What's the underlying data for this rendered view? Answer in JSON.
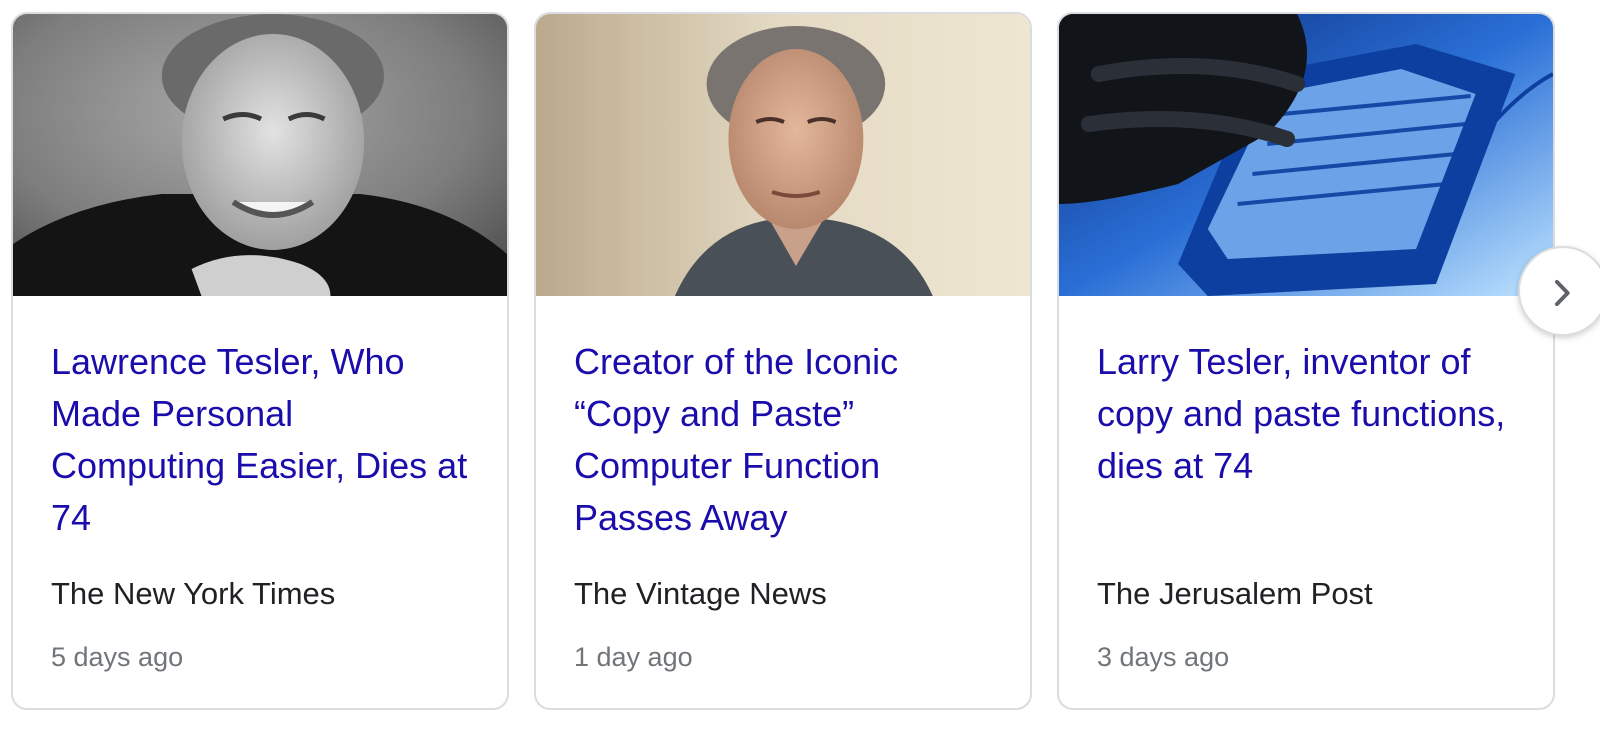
{
  "cards": [
    {
      "headline": "Lawrence Tesler, Who Made Personal Computing Easier, Dies at 74",
      "source": "The New York Times",
      "age": "5 days ago",
      "thumbnail_icon": "portrait-photo-icon"
    },
    {
      "headline": "Creator of the Iconic “Copy and Paste” Computer Function Passes Away",
      "source": "The Vintage News",
      "age": "1 day ago",
      "thumbnail_icon": "portrait-photo-icon"
    },
    {
      "headline": "Larry Tesler, inventor of copy and paste functions, dies at 74",
      "source": "The Jerusalem Post",
      "age": "3 days ago",
      "thumbnail_icon": "keyboard-photo-icon"
    }
  ],
  "next_button_icon": "chevron-right-icon",
  "colors": {
    "headline": "#1a0dab",
    "source": "#202124",
    "age": "#70757a",
    "border": "#dadce0"
  }
}
